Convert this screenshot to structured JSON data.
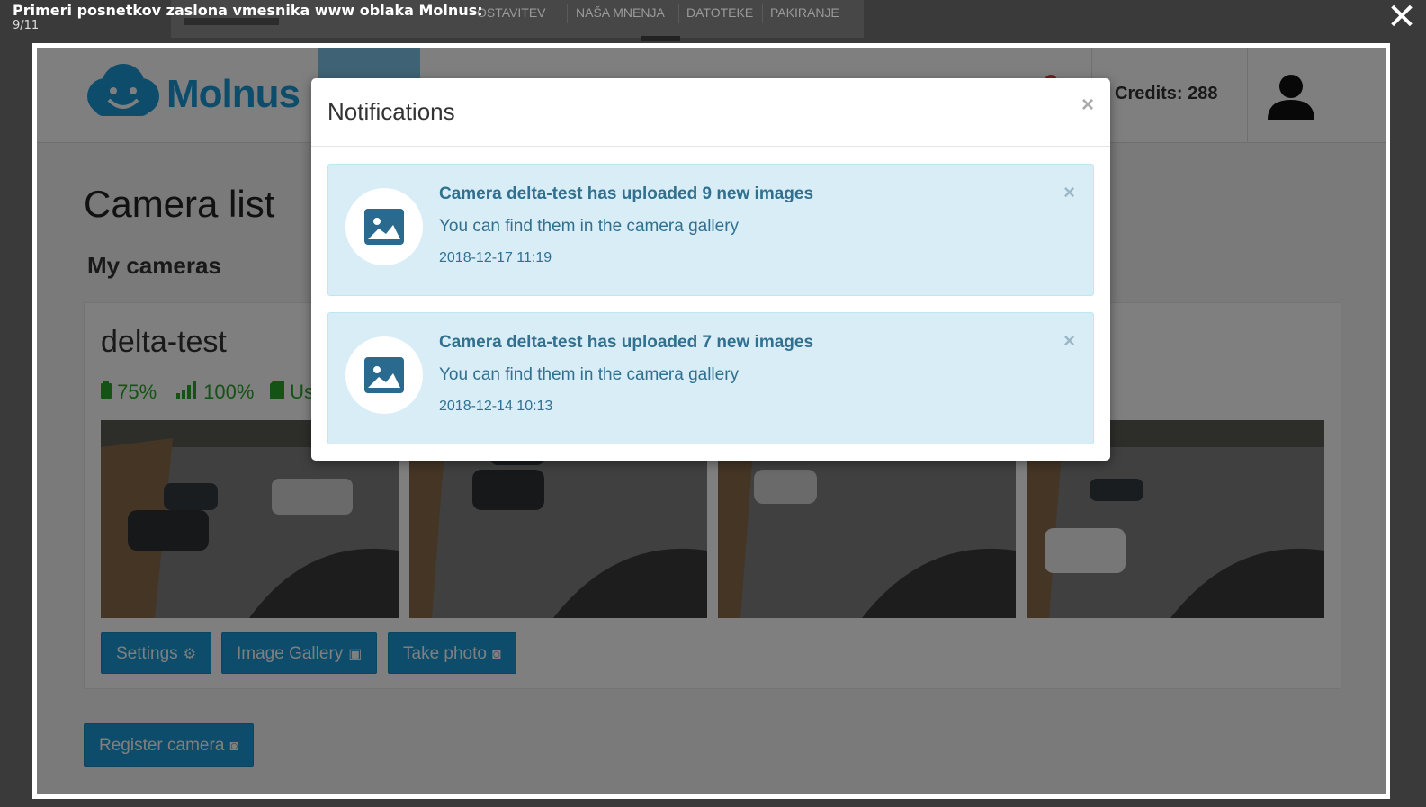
{
  "lightbox": {
    "title": "Primeri posnetkov zaslona vmesnika www oblaka Molnus:",
    "counter": "9/11",
    "close_glyph": "✕"
  },
  "background_nav": {
    "items": [
      "OSTAVITEV",
      "NAŠA MNENJA",
      "DATOTEKE",
      "PAKIRANJE"
    ]
  },
  "header": {
    "logo_text": "Molnus",
    "credits": "Credits: 288",
    "brand_color": "#1a9ad6"
  },
  "main": {
    "page_title": "Camera list",
    "section_title": "My cameras",
    "camera": {
      "name": "delta-test",
      "battery": "75%",
      "signal": "100%",
      "storage_partial": "Us",
      "buttons": {
        "settings": "Settings",
        "gallery": "Image Gallery",
        "take_photo": "Take photo"
      }
    },
    "register_button": "Register camera"
  },
  "modal": {
    "title": "Notifications",
    "close_glyph": "×",
    "notifications": [
      {
        "title": "Camera delta-test has uploaded 9 new images",
        "body": "You can find them in the camera gallery",
        "time": "2018-12-17 11:19"
      },
      {
        "title": "Camera delta-test has uploaded 7 new images",
        "body": "You can find them in the camera gallery",
        "time": "2018-12-14 10:13"
      }
    ]
  },
  "colors": {
    "alert_bg": "#d9edf7",
    "alert_text": "#31708f",
    "status_green": "#2aa52a"
  }
}
